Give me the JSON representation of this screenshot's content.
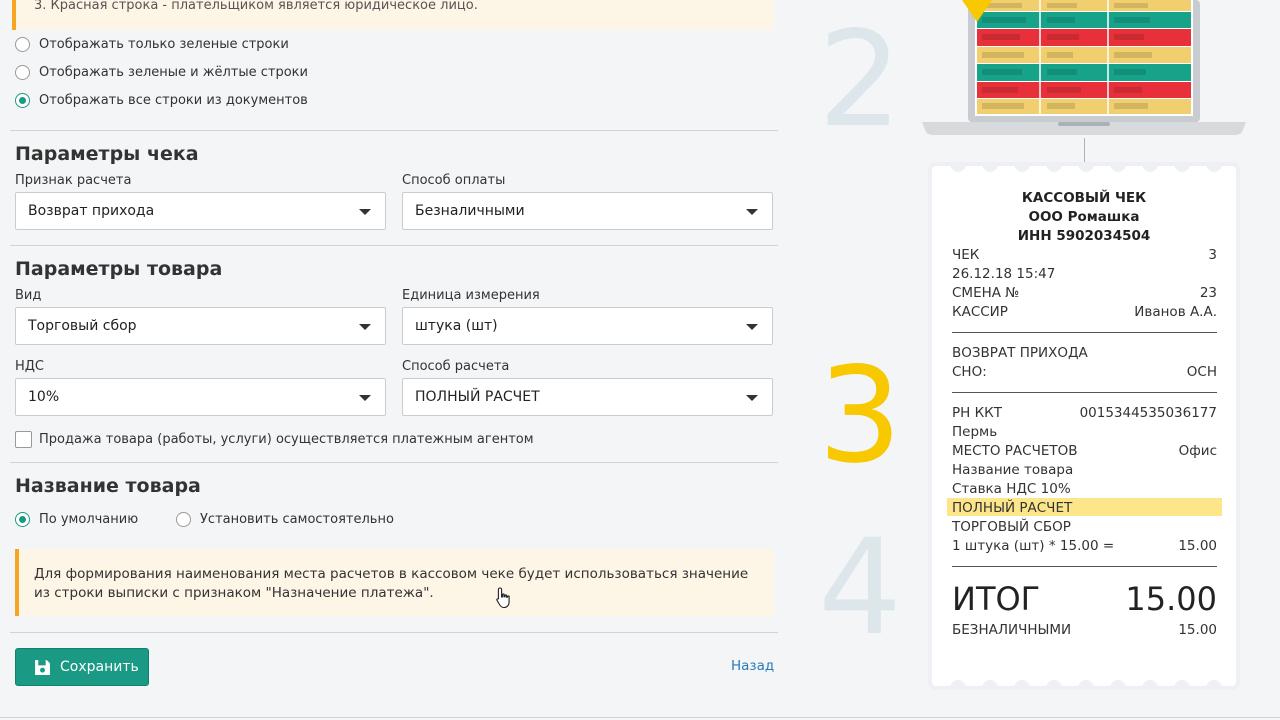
{
  "filter": {
    "note": "3. Красная строка - плательщиком является юридическое лицо.",
    "options": [
      "Отображать только зеленые строки",
      "Отображать зеленые и жёлтые строки",
      "Отображать все строки из документов"
    ],
    "selected_index": 2
  },
  "check_params": {
    "title": "Параметры чека",
    "calc_sign_label": "Признак расчета",
    "calc_sign_value": "Возврат прихода",
    "payment_method_label": "Способ оплаты",
    "payment_method_value": "Безналичными"
  },
  "item_params": {
    "title": "Параметры товара",
    "kind_label": "Вид",
    "kind_value": "Торговый сбор",
    "unit_label": "Единица измерения",
    "unit_value": "штука (шт)",
    "vat_label": "НДС",
    "vat_value": "10%",
    "calc_method_label": "Способ расчета",
    "calc_method_value": "ПОЛНЫЙ РАСЧЕТ",
    "agent_checkbox_label": "Продажа товара (работы, услуги) осуществляется платежным агентом",
    "agent_checked": false
  },
  "item_name": {
    "title": "Название товара",
    "option_default": "По умолчанию",
    "option_custom": "Установить самостоятельно",
    "selected": "default",
    "note": "Для формирования наименования места расчетов в кассовом чеке будет использоваться значение из строки выписки с признаком \"Назначение платежа\"."
  },
  "actions": {
    "save_label": "Сохранить",
    "back_label": "Назад"
  },
  "steps": {
    "two": "2",
    "three": "3",
    "four": "4"
  },
  "receipt": {
    "header_line1": "КАССОВЫЙ ЧЕК",
    "header_line2": "ООО Ромашка",
    "header_line3": "ИНН 5902034504",
    "check_label": "ЧЕК",
    "check_value": "3",
    "datetime": "26.12.18 15:47",
    "shift_label": "СМЕНА №",
    "shift_value": "23",
    "cashier_label": "КАССИР",
    "cashier_value": "Иванов А.А.",
    "operation": "ВОЗВРАТ ПРИХОДА",
    "sno_label": "СНО:",
    "sno_value": "ОСН",
    "rn_label": "РН ККТ",
    "rn_value": "0015344535036177",
    "city": "Пермь",
    "place_label": "МЕСТО РАСЧЕТОВ",
    "place_value": "Офис",
    "item_name": "Название товара",
    "vat_rate": "Ставка НДС 10%",
    "calc_method": "ПОЛНЫЙ РАСЧЕТ",
    "item_kind": "ТОРГОВЫЙ СБОР",
    "qty_line": "1 штука (шт) * 15.00 =",
    "qty_sum": "15.00",
    "total_label": "ИТОГ",
    "total_value": "15.00",
    "cashless_label": "БЕЗНАЛИЧНЫМИ",
    "cashless_value": "15.00"
  },
  "colors": {
    "accent": "#1a9a84",
    "note_border": "#f6a623",
    "step_gray": "#dde6ea",
    "step_yellow": "#f8c800",
    "highlight": "#fde68a"
  }
}
